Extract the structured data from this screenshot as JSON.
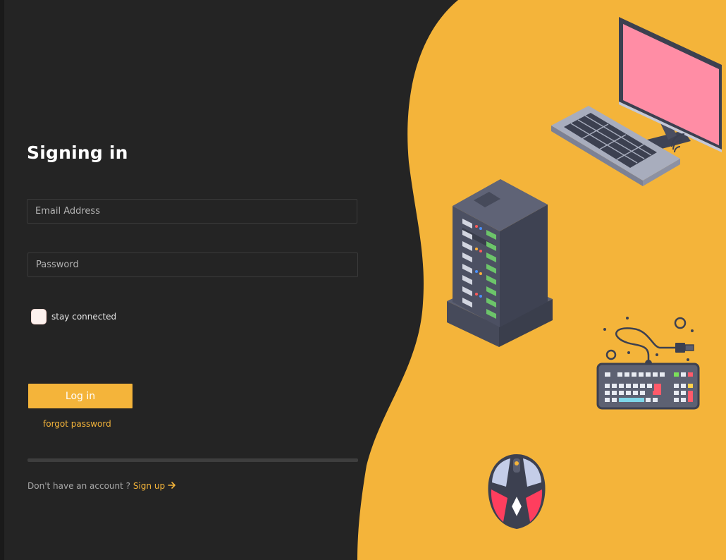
{
  "login": {
    "title": "Signing in",
    "email_placeholder": "Email Address",
    "password_placeholder": "Password",
    "remember_label": "stay connected",
    "remember_checked": false,
    "login_button": "Log in",
    "forgot_link": "forgot password",
    "signup_prompt": "Don't have an account ? ",
    "signup_link": "Sign up"
  },
  "illustrations": {
    "items": [
      "monitor-keyboard-icon",
      "server-rack-icon",
      "usb-keyboard-icon",
      "gaming-mouse-icon"
    ]
  },
  "colors": {
    "background": "#242424",
    "accent": "#f4b43a",
    "text": "#ffffff"
  }
}
